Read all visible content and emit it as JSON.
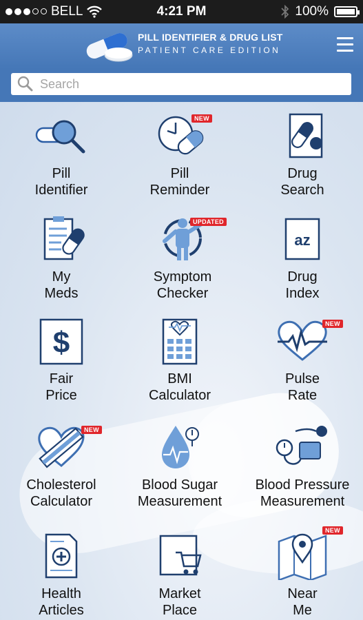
{
  "status_bar": {
    "carrier": "BELL",
    "time": "4:21 PM",
    "battery": "100%"
  },
  "header": {
    "title_line1": "PILL IDENTIFIER & DRUG LIST",
    "title_line2": "PATIENT CARE EDITION"
  },
  "search": {
    "placeholder": "Search"
  },
  "tiles": [
    {
      "line1": "Pill",
      "line2": "Identifier",
      "badge": "",
      "icon": "magnifier-pill-icon"
    },
    {
      "line1": "Pill",
      "line2": "Reminder",
      "badge": "NEW",
      "icon": "clock-pill-icon"
    },
    {
      "line1": "Drug",
      "line2": "Search",
      "badge": "",
      "icon": "drug-search-icon"
    },
    {
      "line1": "My",
      "line2": "Meds",
      "badge": "",
      "icon": "clipboard-pill-icon"
    },
    {
      "line1": "Symptom",
      "line2": "Checker",
      "badge": "UPDATED",
      "icon": "body-symptom-icon"
    },
    {
      "line1": "Drug",
      "line2": "Index",
      "badge": "",
      "icon": "az-index-icon"
    },
    {
      "line1": "Fair",
      "line2": "Price",
      "badge": "",
      "icon": "dollar-icon"
    },
    {
      "line1": "BMI",
      "line2": "Calculator",
      "badge": "",
      "icon": "calculator-heart-icon"
    },
    {
      "line1": "Pulse",
      "line2": "Rate",
      "badge": "NEW",
      "icon": "heart-pulse-icon"
    },
    {
      "line1": "Cholesterol",
      "line2": "Calculator",
      "badge": "NEW",
      "icon": "heart-artery-icon"
    },
    {
      "line1": "Blood Sugar",
      "line2": "Measurement",
      "badge": "",
      "icon": "blood-drop-icon"
    },
    {
      "line1": "Blood Pressure",
      "line2": "Measurement",
      "badge": "",
      "icon": "blood-pressure-icon"
    },
    {
      "line1": "Health",
      "line2": "Articles",
      "badge": "",
      "icon": "document-plus-icon"
    },
    {
      "line1": "Market",
      "line2": "Place",
      "badge": "",
      "icon": "shopping-cart-icon"
    },
    {
      "line1": "Near",
      "line2": "Me",
      "badge": "NEW",
      "icon": "map-pin-icon"
    }
  ],
  "colors": {
    "header": "#4577b7",
    "accent": "#3e6fb2",
    "badge": "#e0262b"
  }
}
